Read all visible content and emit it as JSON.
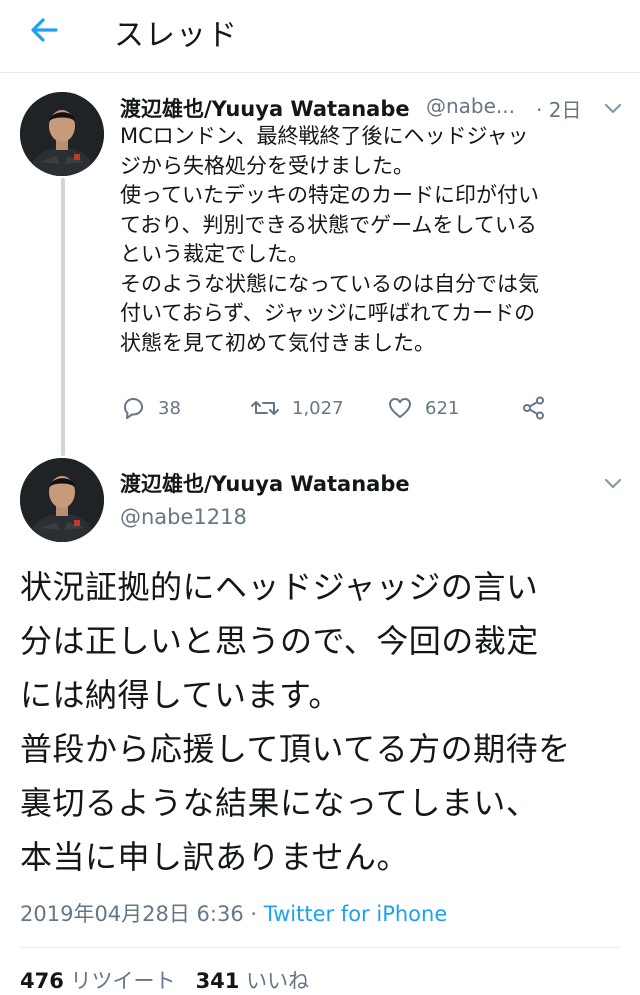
{
  "header": {
    "title": "スレッド"
  },
  "tweet1": {
    "author_name": "渡辺雄也/Yuuya Watanabe",
    "handle": "@nabe...",
    "time": "· 2日",
    "lines": [
      "MCロンドン、最終戦終了後にヘッドジャッ",
      "ジから失格処分を受けました。",
      "使っていたデッキの特定のカードに印が付い",
      "ており、判別できる状態でゲームをしている",
      "という裁定でした。",
      "そのような状態になっているのは自分では気",
      "付いておらず、ジャッジに呼ばれてカードの",
      "状態を見て初めて気付きました。"
    ],
    "replies": "38",
    "retweets": "1,027",
    "likes": "621"
  },
  "tweet2": {
    "author_name": "渡辺雄也/Yuuya Watanabe",
    "handle": "@nabe1218",
    "lines": [
      "状況証拠的にヘッドジャッジの言い",
      "分は正しいと思うので、今回の裁定",
      "には納得しています。",
      "普段から応援して頂いてる方の期待を",
      "裏切るような結果になってしまい、",
      "本当に申し訳ありません。"
    ],
    "timestamp": "2019年04月28日 6:36 · ",
    "via": "Twitter for iPhone",
    "stats_retweets": "476",
    "stats_retweets_label": "リツイート",
    "stats_likes": "341",
    "stats_likes_label": "いいね"
  },
  "colors": {
    "accent": "#1da1f2",
    "secondary_text": "#657786",
    "line": "#ccd6dd"
  },
  "icons": [
    "back-arrow-icon",
    "chevron-down-icon",
    "reply-icon",
    "retweet-icon",
    "like-icon",
    "share-icon"
  ]
}
